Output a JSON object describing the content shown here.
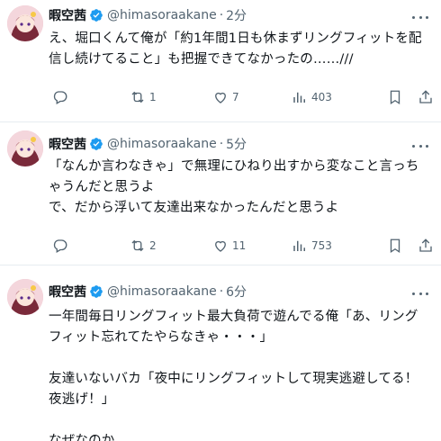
{
  "tweets": [
    {
      "name": "暇空茜",
      "handle": "@himasoraakane",
      "dot": "·",
      "time": "2分",
      "text": "え、堀口くんて俺が「約1年間1日も休まずリングフィットを配信し続けてること」も把握できてなかったの……///",
      "replies": "",
      "retweets": "1",
      "likes": "7",
      "views": "403"
    },
    {
      "name": "暇空茜",
      "handle": "@himasoraakane",
      "dot": "·",
      "time": "5分",
      "text": "「なんか言わなきゃ」で無理にひねり出すから変なこと言っちゃうんだと思うよ\nで、だから浮いて友達出来なかったんだと思うよ",
      "replies": "",
      "retweets": "2",
      "likes": "11",
      "views": "753"
    },
    {
      "name": "暇空茜",
      "handle": "@himasoraakane",
      "dot": "·",
      "time": "6分",
      "text": "一年間毎日リングフィット最大負荷で遊んでる俺「あ、リングフィット忘れてたやらなきゃ・・・」\n\n友達いないバカ「夜中にリングフィットして現実逃避してる！夜逃げ！」\n\nなぜなのか",
      "replies": "",
      "retweets": "",
      "likes": "",
      "views": ""
    }
  ],
  "colors": {
    "text": "#0f1419",
    "muted": "#536471",
    "verified": "#1d9bf0",
    "divider": "#e6ecf0"
  },
  "icons": [
    "verified-badge-icon",
    "more-icon",
    "reply-icon",
    "retweet-icon",
    "like-icon",
    "views-icon",
    "bookmark-icon",
    "share-icon"
  ]
}
